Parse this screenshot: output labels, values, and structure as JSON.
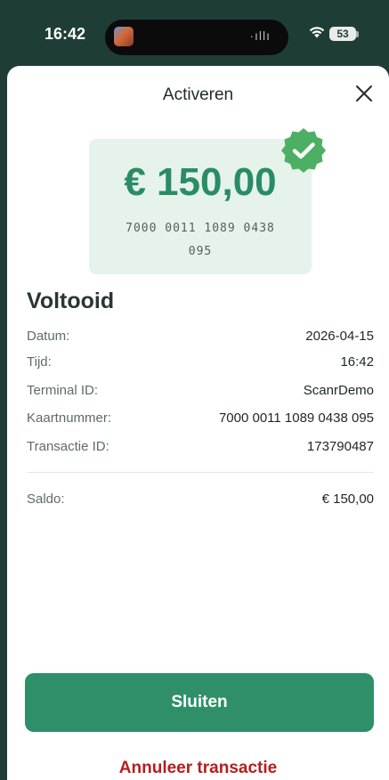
{
  "status_bar": {
    "time": "16:42",
    "audio_indicator": "·ıllı",
    "wifi_icon": "wifi-icon",
    "battery": "53"
  },
  "header": {
    "title": "Activeren",
    "close_icon": "close-icon"
  },
  "card": {
    "amount": "€ 150,00",
    "number_line1": "7000 0011 1089 0438",
    "number_line2": "095",
    "badge_icon": "check-badge-icon",
    "badge_color": "#4caf63",
    "bg_color": "#e6f3ea",
    "amount_color": "#2a8c64"
  },
  "result": {
    "status": "Voltooid",
    "rows": [
      {
        "label": "Datum:",
        "value": "2026-04-15"
      },
      {
        "label": "Tijd:",
        "value": "16:42"
      },
      {
        "label": "Terminal ID:",
        "value": "ScanrDemo"
      },
      {
        "label": "Kaartnummer:",
        "value": "7000 0011 1089 0438 095"
      },
      {
        "label": "Transactie ID:",
        "value": "173790487"
      }
    ],
    "balance": {
      "label": "Saldo:",
      "value": "€ 150,00"
    }
  },
  "actions": {
    "close_label": "Sluiten",
    "cancel_label": "Annuleer transactie",
    "primary_color": "#2e8f69",
    "danger_color": "#b41e1e"
  }
}
